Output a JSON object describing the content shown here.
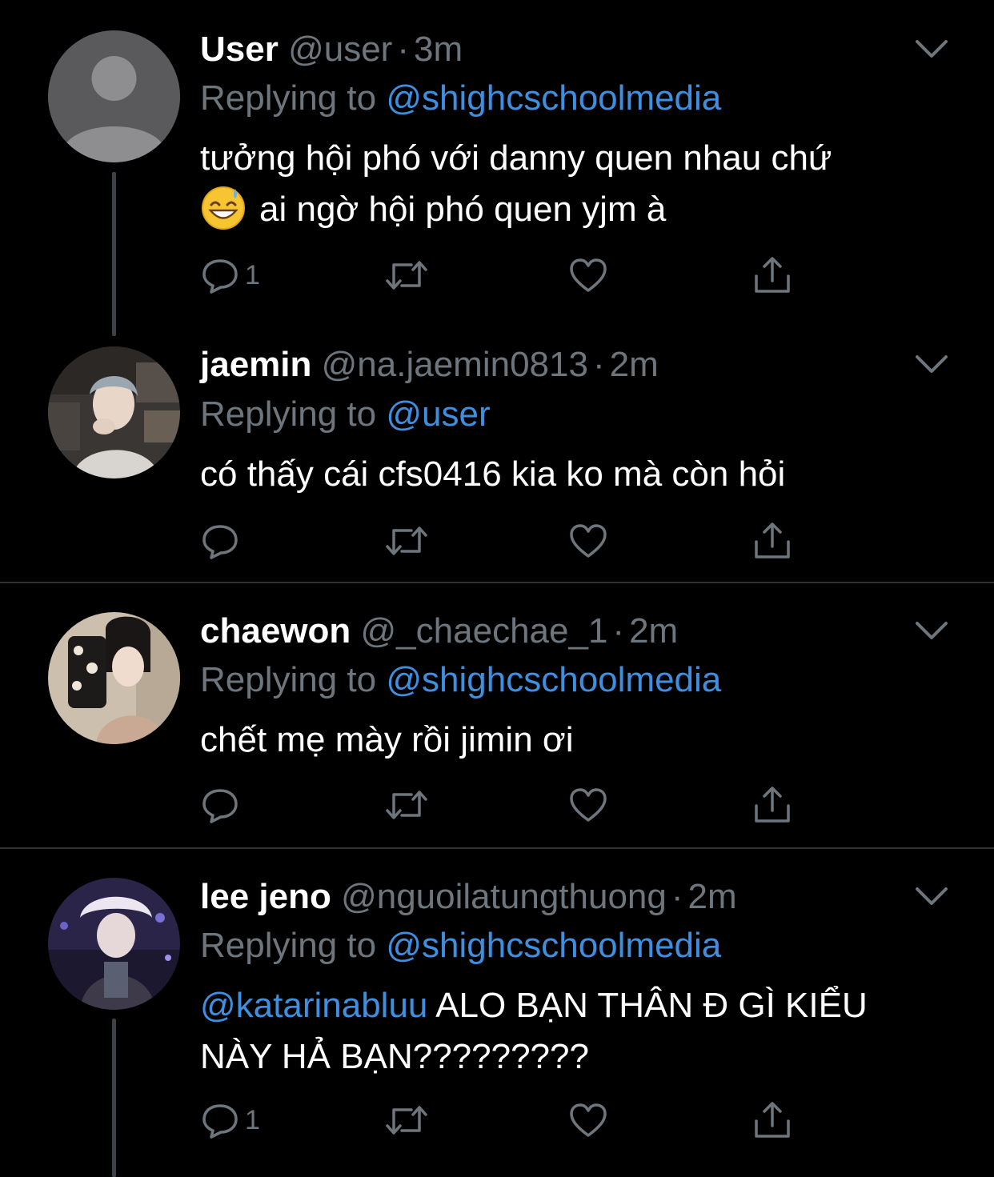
{
  "tweets": [
    {
      "name": "User",
      "handle": "@user",
      "time": "3m",
      "replying_prefix": "Replying to",
      "replying_to": "@shighcschoolmedia",
      "text_line1": "tưởng hội phó với danny quen nhau chứ",
      "text_line2": "ai ngờ hội phó quen yjm à",
      "emoji": "grinning-sweat-emoji",
      "reply_count": "1",
      "avatar": "default-avatar"
    },
    {
      "name": "jaemin",
      "handle": "@na.jaemin0813",
      "time": "2m",
      "replying_prefix": "Replying to",
      "replying_to": "@user",
      "text_line1": "có thấy cái cfs0416 kia ko mà còn hỏi",
      "reply_count": "",
      "avatar": "photo-avatar"
    },
    {
      "name": "chaewon",
      "handle": "@_chaechae_1",
      "time": "2m",
      "replying_prefix": "Replying to",
      "replying_to": "@shighcschoolmedia",
      "text_line1": "chết mẹ mày rồi jimin ơi",
      "reply_count": "",
      "avatar": "photo-avatar"
    },
    {
      "name": "lee jeno",
      "handle": "@nguoilatungthuong",
      "time": "2m",
      "replying_prefix": "Replying to",
      "replying_to": "@shighcschoolmedia",
      "mention": "@katarinabluu",
      "text_line1": "ALO BẠN THÂN Đ GÌ KIỂU",
      "text_line2": "NÀY HẢ BẠN?????????",
      "reply_count": "1",
      "avatar": "photo-avatar"
    }
  ],
  "separator": "·",
  "colors": {
    "background": "#000000",
    "text": "#ffffff",
    "muted": "#6e767d",
    "link": "#3f8fe0",
    "divider": "#2f3336"
  },
  "icons": [
    "reply-icon",
    "retweet-icon",
    "like-icon",
    "share-icon",
    "chevron-down-icon"
  ]
}
